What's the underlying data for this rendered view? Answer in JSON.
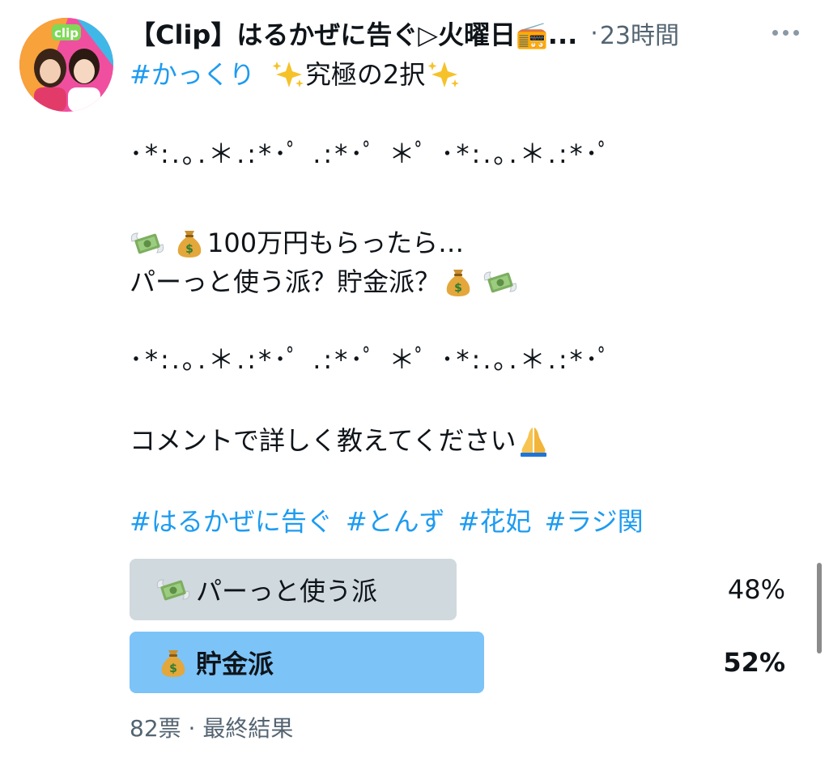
{
  "tweet": {
    "author_name": "【Clip】はるかぜに告ぐ▷火曜日📻...",
    "separator": "·",
    "time_ago": "23時間",
    "lines": {
      "l1_hashtag": "#かっくり",
      "l1_text": "究極の2択",
      "deco_1": "･*:.｡.＊.:*･ﾟ .:*･ﾟ ＊ﾟ ･*:.｡.＊.:*･ﾟ",
      "l3_text": "100万円もらったら…",
      "l4_text": "パーっと使う派？貯金派？",
      "deco_2": "･*:.｡.＊.:*･ﾟ .:*･ﾟ ＊ﾟ ･*:.｡.＊.:*･ﾟ",
      "l6_text": "コメントで詳しく教えてください",
      "hashtags": [
        "#はるかぜに告ぐ",
        "#とんず",
        "#花妃",
        "#ラジ関"
      ]
    },
    "icons": {
      "sparkles": "sparkles-icon",
      "money_wings": "money-with-wings-icon",
      "money_bag": "money-bag-icon",
      "pray": "folded-hands-icon",
      "radio": "radio-icon"
    }
  },
  "poll": {
    "options": [
      {
        "label": "パーっと使う派",
        "percent_text": "48%",
        "percent": 48,
        "winner": false,
        "color": "#cfd9de"
      },
      {
        "label": "貯金派",
        "percent_text": "52%",
        "percent": 52,
        "winner": true,
        "color": "#7cc3f7"
      }
    ],
    "meta": "82票 · 最終結果"
  },
  "colors": {
    "accent": "#1d9bf0",
    "text": "#0f1419",
    "muted": "#536471"
  }
}
